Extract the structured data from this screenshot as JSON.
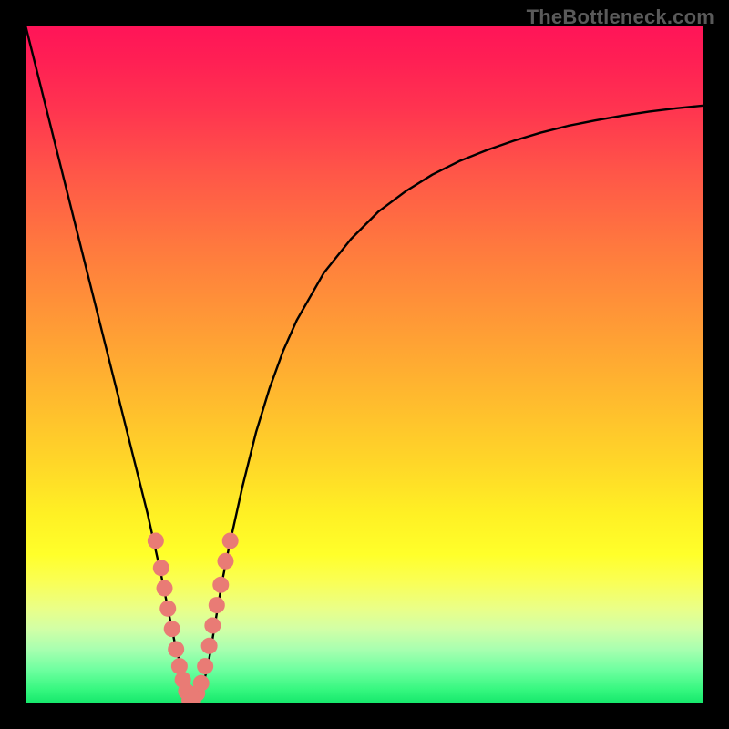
{
  "watermark": "TheBottleneck.com",
  "colors": {
    "frame": "#000000",
    "curve": "#000000",
    "marker": "#e97b75",
    "gradient_top": "#ff1458",
    "gradient_bottom": "#15e86b"
  },
  "chart_data": {
    "type": "line",
    "title": "",
    "xlabel": "",
    "ylabel": "",
    "xlim": [
      0,
      100
    ],
    "ylim": [
      0,
      100
    ],
    "grid": false,
    "legend": false,
    "annotations": [
      "TheBottleneck.com"
    ],
    "series": [
      {
        "name": "bottleneck-curve",
        "x": [
          0.0,
          2.0,
          4.0,
          6.0,
          8.0,
          10.0,
          12.0,
          14.0,
          16.0,
          18.0,
          20.0,
          21.0,
          22.0,
          23.0,
          23.6,
          24.3,
          25.0,
          26.0,
          27.0,
          28.0,
          29.0,
          30.0,
          32.0,
          34.0,
          36.0,
          38.0,
          40.0,
          44.0,
          48.0,
          52.0,
          56.0,
          60.0,
          64.0,
          68.0,
          72.0,
          76.0,
          80.0,
          84.0,
          88.0,
          92.0,
          96.0,
          100.0
        ],
        "y": [
          100.0,
          92.0,
          84.0,
          76.0,
          68.0,
          60.0,
          52.0,
          44.0,
          36.0,
          28.0,
          19.0,
          14.0,
          9.0,
          5.0,
          2.0,
          0.3,
          0.3,
          2.0,
          6.0,
          12.0,
          18.0,
          23.0,
          32.0,
          40.0,
          46.5,
          52.0,
          56.5,
          63.5,
          68.5,
          72.5,
          75.5,
          78.0,
          80.0,
          81.6,
          83.0,
          84.2,
          85.2,
          86.0,
          86.7,
          87.3,
          87.8,
          88.2
        ]
      }
    ],
    "markers": {
      "name": "highlighted-points",
      "color": "#e97b75",
      "points": [
        {
          "x": 19.2,
          "y": 24.0
        },
        {
          "x": 20.0,
          "y": 20.0
        },
        {
          "x": 20.5,
          "y": 17.0
        },
        {
          "x": 21.0,
          "y": 14.0
        },
        {
          "x": 21.6,
          "y": 11.0
        },
        {
          "x": 22.2,
          "y": 8.0
        },
        {
          "x": 22.7,
          "y": 5.5
        },
        {
          "x": 23.2,
          "y": 3.5
        },
        {
          "x": 23.7,
          "y": 1.8
        },
        {
          "x": 24.2,
          "y": 0.5
        },
        {
          "x": 24.7,
          "y": 0.5
        },
        {
          "x": 25.3,
          "y": 1.5
        },
        {
          "x": 25.9,
          "y": 3.0
        },
        {
          "x": 26.5,
          "y": 5.5
        },
        {
          "x": 27.1,
          "y": 8.5
        },
        {
          "x": 27.6,
          "y": 11.5
        },
        {
          "x": 28.2,
          "y": 14.5
        },
        {
          "x": 28.8,
          "y": 17.5
        },
        {
          "x": 29.5,
          "y": 21.0
        },
        {
          "x": 30.2,
          "y": 24.0
        }
      ]
    }
  }
}
